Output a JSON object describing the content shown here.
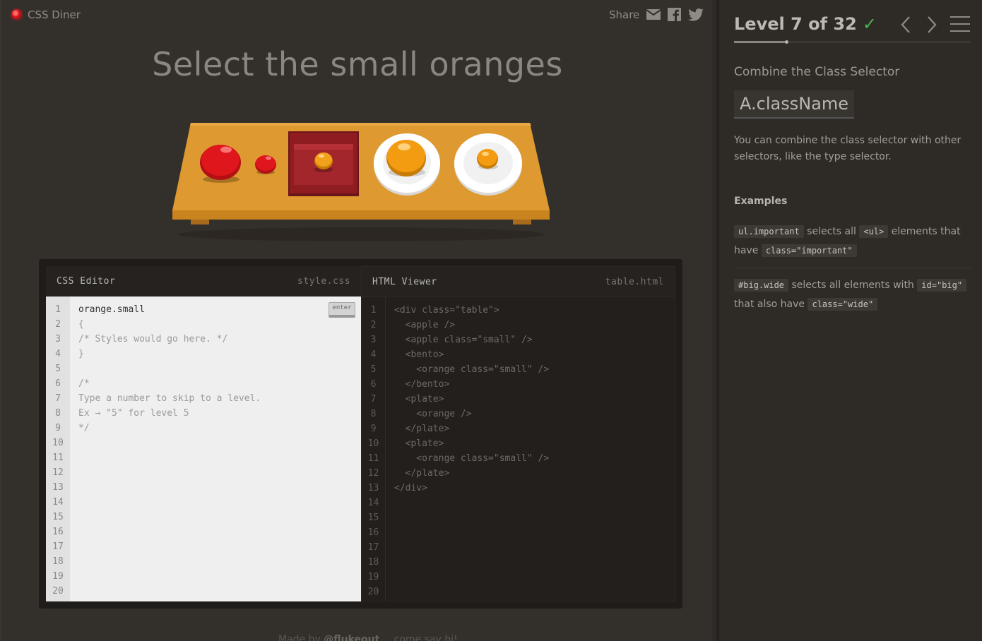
{
  "app": {
    "logo_text": "CSS Diner",
    "share_label": "Share"
  },
  "instruction": "Select the small oranges",
  "table_items": [
    {
      "type": "apple",
      "size": "normal"
    },
    {
      "type": "apple",
      "size": "small"
    },
    {
      "type": "bento",
      "contains": "orange small"
    },
    {
      "type": "plate",
      "contains": "orange"
    },
    {
      "type": "plate",
      "contains": "orange small"
    }
  ],
  "css_editor": {
    "title": "CSS Editor",
    "filename": "style.css",
    "enter_label": "enter",
    "line_numbers": [
      "1",
      "2",
      "3",
      "4",
      "5",
      "6",
      "7",
      "8",
      "9",
      "10",
      "11",
      "12",
      "13",
      "14",
      "15",
      "16",
      "17",
      "18",
      "19",
      "20"
    ],
    "input_value": "orange.small",
    "lines": [
      "{",
      "/* Styles would go here. */",
      "}",
      "",
      "/*",
      "Type a number to skip to a level.",
      "Ex → \"5\" for level 5",
      "*/"
    ]
  },
  "html_viewer": {
    "title": "HTML Viewer",
    "filename": "table.html",
    "line_numbers": [
      "1",
      "2",
      "3",
      "4",
      "5",
      "6",
      "7",
      "8",
      "9",
      "10",
      "11",
      "12",
      "13",
      "14",
      "15",
      "16",
      "17",
      "18",
      "19",
      "20"
    ],
    "lines": [
      "<div class=\"table\">",
      "  <apple />",
      "  <apple class=\"small\" />",
      "  <bento>",
      "    <orange class=\"small\" />",
      "  </bento>",
      "  <plate>",
      "    <orange />",
      "  </plate>",
      "  <plate>",
      "    <orange class=\"small\" />",
      "  </plate>",
      "</div>"
    ]
  },
  "footer": {
    "made_by_prefix": "Made by ",
    "made_by_handle": "@flukeout",
    "say_hi": "come say hi!"
  },
  "sidebar": {
    "level_label": "Level 7 of 32",
    "level_completed_mark": "✓",
    "progress": 0.22,
    "selector_name": "Combine the Class Selector",
    "selector_syntax": "A.className",
    "hint": "You can combine the class selector with other selectors, like the type selector.",
    "examples_title": "Examples",
    "example1": {
      "code1": "ul.important",
      "text1": "selects all",
      "code2": "<ul>",
      "text2": "elements that have",
      "code3": "class=\"important\""
    },
    "example2": {
      "code1": "#big.wide",
      "text1": "selects all elements with",
      "code2": "id=\"big\"",
      "text2": "that also have",
      "code3": "class=\"wide\""
    }
  },
  "colors": {
    "apple": "#d8141b",
    "orange": "#f39c12",
    "table": "#de9a31",
    "bento": "#a3262c",
    "check": "#4cb050"
  }
}
